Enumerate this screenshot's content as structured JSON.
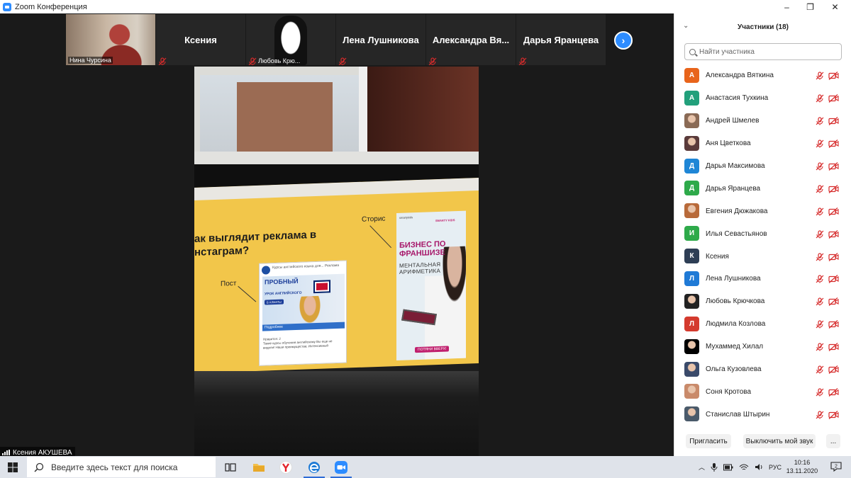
{
  "window": {
    "title": "Zoom Конференция",
    "minimize_glyph": "–",
    "maximize_glyph": "❐",
    "close_glyph": "✕"
  },
  "thumbnails": [
    {
      "name": "Нина Чурсина",
      "type": "video-nina",
      "muted": false
    },
    {
      "name": "Ксения",
      "type": "name",
      "muted": true
    },
    {
      "name": "Любовь Крю...",
      "type": "video-lubov",
      "muted": true
    },
    {
      "name": "Лена Лушникова",
      "type": "name",
      "muted": true
    },
    {
      "name": "Александра  Вя...",
      "type": "name",
      "muted": true
    },
    {
      "name": "Дарья Яранцева",
      "type": "name",
      "muted": true
    }
  ],
  "next_page_glyph": "›",
  "main_video": {
    "speaker_name": "Ксения АКУШЕВА",
    "slide": {
      "heading_line1": "ак выглядит реклама в",
      "heading_line2": "нстаграм?",
      "label_post": "Пост",
      "label_stories": "Сторис",
      "post_account": "Курсы английского языка для... Реклама",
      "post_title": "ПРОБНЫЙ",
      "post_subtitle": "УРОК АНГЛИЙСКОГО",
      "post_badge": "В АЛМАТЫ",
      "post_more": "Подробнее",
      "post_likes": "Нравится: 2",
      "post_text": "Такие курсы обучения английскому Вы еще не видели! Наши преимущества: Интенсивный",
      "story_account": "smartykids",
      "story_brand": "SMARTY KIDS",
      "story_title": "БИЗНЕС ПО ФРАНШИЗЕ",
      "story_subtitle": "МЕНТАЛЬНАЯ АРИФМЕТИКА",
      "story_cta": "ПОТЯНИ ВВЕРХ!"
    }
  },
  "panel": {
    "title": "Участники (18)",
    "collapse_glyph": "⌄",
    "search_placeholder": "Найти участника",
    "participants": [
      {
        "name": "Александра Вяткина",
        "initial": "А",
        "color": "#e8641b",
        "photo": false
      },
      {
        "name": "Анастасия Тухкина",
        "initial": "А",
        "color": "#22a07b",
        "photo": false
      },
      {
        "name": "Андрей Шмелев",
        "initial": "",
        "color": "#8a6a55",
        "photo": true
      },
      {
        "name": "Аня Цветкова",
        "initial": "",
        "color": "#5a3a3a",
        "photo": true
      },
      {
        "name": "Дарья Максимова",
        "initial": "Д",
        "color": "#1f86d6",
        "photo": false
      },
      {
        "name": "Дарья Яранцева",
        "initial": "Д",
        "color": "#2eaa4a",
        "photo": false
      },
      {
        "name": "Евгения Дюжакова",
        "initial": "",
        "color": "#b86a3a",
        "photo": true
      },
      {
        "name": "Илья Севастьянов",
        "initial": "И",
        "color": "#2eaa4a",
        "photo": false
      },
      {
        "name": "Ксения",
        "initial": "К",
        "color": "#2e3e55",
        "photo": false
      },
      {
        "name": "Лена Лушникова",
        "initial": "Л",
        "color": "#1f7ad6",
        "photo": false
      },
      {
        "name": "Любовь Крючкова",
        "initial": "",
        "color": "#222222",
        "photo": true
      },
      {
        "name": "Людмила Козлова",
        "initial": "Л",
        "color": "#d43a2e",
        "photo": false
      },
      {
        "name": "Мухаммед Хилал",
        "initial": "",
        "color": "#000000",
        "photo": true
      },
      {
        "name": "Ольга Кузовлева",
        "initial": "",
        "color": "#3a4a6a",
        "photo": true
      },
      {
        "name": "Соня Кротова",
        "initial": "",
        "color": "#c98a6a",
        "photo": true
      },
      {
        "name": "Станислав Штырин",
        "initial": "",
        "color": "#4a5a6a",
        "photo": true
      }
    ],
    "invite_label": "Пригласить",
    "mute_all_label": "Выключить мой звук",
    "more_label": "..."
  },
  "taskbar": {
    "search_placeholder": "Введите здесь текст для поиска",
    "language": "РУС",
    "time": "10:16",
    "date": "13.11.2020",
    "notifications_count": "2"
  },
  "colors": {
    "accent": "#2d8cff",
    "muted_red": "#d62b2b"
  }
}
